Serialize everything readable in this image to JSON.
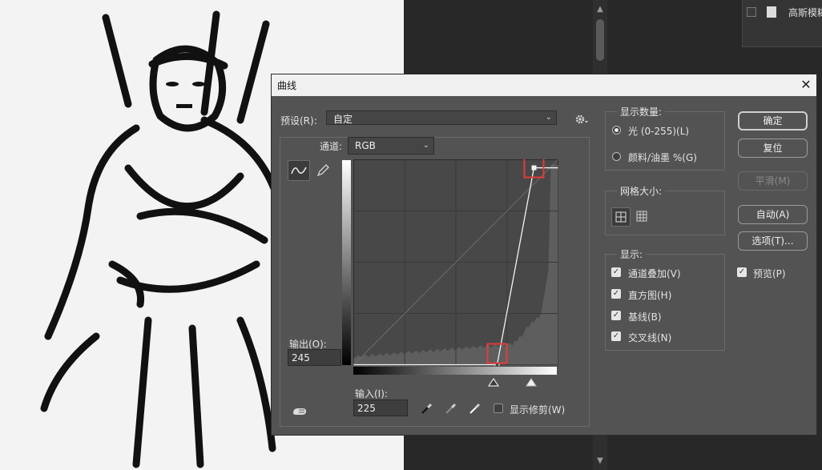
{
  "background": {
    "layers_panel": {
      "layer_name": "高斯模糊"
    }
  },
  "dialog": {
    "title": "曲线",
    "preset_label": "预设(R):",
    "preset_value": "自定",
    "channel_label": "通道:",
    "channel_value": "RGB",
    "output_label": "输出(O):",
    "output_value": "245",
    "input_label": "输入(I):",
    "input_value": "225",
    "show_clipping_label": "显示修剪(W)",
    "show_clipping_checked": false,
    "display_amount": {
      "title": "显示数量:",
      "light_label": "光 (0-255)(L)",
      "pigment_label": "颜料/油墨 %(G)",
      "selected": "light"
    },
    "grid_size": {
      "title": "网格大小:"
    },
    "show": {
      "title": "显示:",
      "items": [
        {
          "label": "通道叠加(V)",
          "checked": true
        },
        {
          "label": "直方图(H)",
          "checked": true
        },
        {
          "label": "基线(B)",
          "checked": true
        },
        {
          "label": "交叉线(N)",
          "checked": true
        }
      ]
    },
    "buttons": {
      "ok": "确定",
      "reset": "复位",
      "smooth": "平滑(M)",
      "auto": "自动(A)",
      "options": "选项(T)..."
    },
    "preview_label": "预览(P)",
    "preview_checked": true,
    "curve_points": [
      {
        "input": 0,
        "output": 0
      },
      {
        "input": 179,
        "output": 0
      },
      {
        "input": 225,
        "output": 245
      },
      {
        "input": 255,
        "output": 245
      }
    ],
    "accent_color": "#e23c3c"
  }
}
